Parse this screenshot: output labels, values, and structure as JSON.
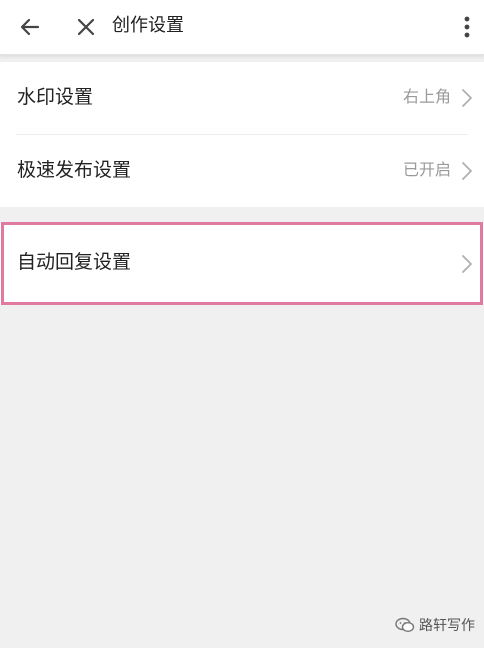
{
  "header": {
    "title": "创作设置",
    "back_icon": "arrow-left-icon",
    "close_icon": "close-icon",
    "more_icon": "more-vertical-icon"
  },
  "settings": {
    "watermark": {
      "label": "水印设置",
      "value": "右上角"
    },
    "fast_publish": {
      "label": "极速发布设置",
      "value": "已开启"
    },
    "auto_reply": {
      "label": "自动回复设置"
    }
  },
  "highlight_color": "#e07aa0",
  "watermark_brand": {
    "icon": "wechat-icon",
    "text": "路轩写作"
  }
}
